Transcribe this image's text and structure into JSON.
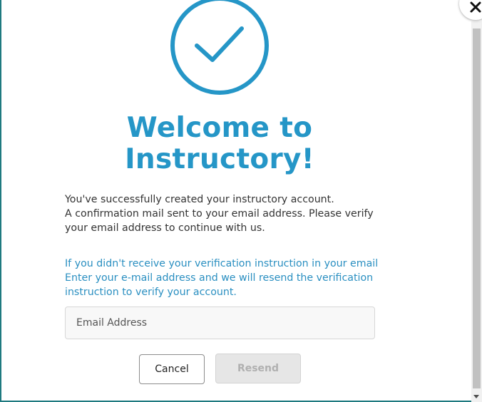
{
  "modal": {
    "title_line1": "Welcome to",
    "title_line2": "Instructory!",
    "success_lines": [
      "You've successfully created your instructory account.",
      "A confirmation mail sent to your email address. Please verify",
      "your email address to continue with us."
    ],
    "resend_lines": [
      "If you didn't receive your verification instruction in your email",
      "Enter your e-mail address and we will resend the verification",
      "instruction to verify your account."
    ],
    "email_field": {
      "placeholder": "Email Address",
      "value": ""
    },
    "buttons": {
      "cancel_label": "Cancel",
      "resend_label": "Resend"
    },
    "icons": {
      "success": "checkmark-circle-icon",
      "close": "close-icon"
    }
  },
  "colors": {
    "accent": "#2596c7",
    "link_text": "#2a8fc1",
    "body_text": "#333333",
    "disabled_button_bg": "#e6e6e6",
    "disabled_button_text": "#b0b0b0"
  }
}
